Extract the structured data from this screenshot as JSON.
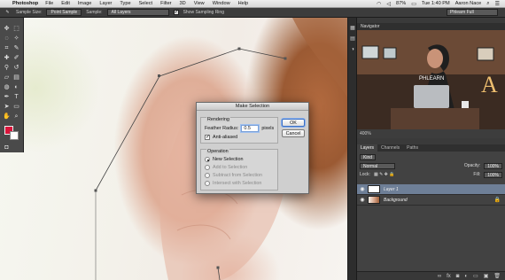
{
  "menubar": {
    "app_name": "Photoshop",
    "items": [
      "File",
      "Edit",
      "Image",
      "Layer",
      "Type",
      "Select",
      "Filter",
      "3D",
      "View",
      "Window",
      "Help"
    ],
    "battery": "87%",
    "clock": "Tue 1:40 PM",
    "user": "Aaron Nace"
  },
  "options_bar": {
    "sample_size_label": "Sample Size:",
    "sample_size_value": "Point Sample",
    "sample_label": "Sample:",
    "sample_value": "All Layers",
    "show_ring_label": "Show Sampling Ring",
    "workspace": "Phlearn Full"
  },
  "navigator": {
    "title": "Navigator",
    "zoom": "400%",
    "preview_logo_text": "PHLEARN",
    "preview_letter": "A"
  },
  "layers_panel": {
    "tabs": [
      "Layers",
      "Channels",
      "Paths"
    ],
    "active_tab": "Layers",
    "filter_kind": "Kind",
    "blend_mode": "Normal",
    "opacity_label": "Opacity:",
    "opacity_value": "100%",
    "lock_label": "Lock:",
    "fill_label": "Fill:",
    "fill_value": "100%",
    "layers": [
      {
        "name": "Layer 1",
        "selected": true
      },
      {
        "name": "Background",
        "selected": false,
        "locked": true
      }
    ]
  },
  "dialog": {
    "title": "Make Selection",
    "rendering_label": "Rendering",
    "feather_label": "Feather Radius:",
    "feather_value": "0.5",
    "feather_unit": "pixels",
    "antialiased_label": "Anti-aliased",
    "operation_label": "Operation",
    "operations": [
      {
        "label": "New Selection",
        "checked": true,
        "enabled": true
      },
      {
        "label": "Add to Selection",
        "checked": false,
        "enabled": false
      },
      {
        "label": "Subtract from Selection",
        "checked": false,
        "enabled": false
      },
      {
        "label": "Intersect with Selection",
        "checked": false,
        "enabled": false
      }
    ],
    "ok_label": "OK",
    "cancel_label": "Cancel"
  },
  "colors": {
    "foreground": "#d9143a",
    "background": "#ffffff",
    "selected_layer": "#6e7f97"
  }
}
